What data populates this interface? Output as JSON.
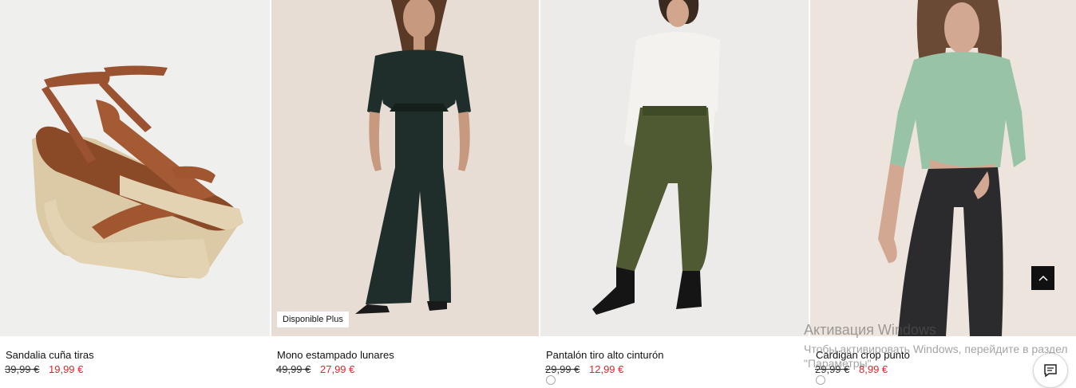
{
  "products": [
    {
      "name": "Sandalia cuña tiras",
      "old_price": "39,99 €",
      "sale_price": "19,99 €",
      "image_icon": "wedge-sandal-photo"
    },
    {
      "name": "Mono estampado lunares",
      "old_price": "49,99 €",
      "sale_price": "27,99 €",
      "badge": "Disponible Plus",
      "image_icon": "jumpsuit-photo"
    },
    {
      "name": "Pantalón tiro alto cinturón",
      "old_price": "29,99 €",
      "sale_price": "12,99 €",
      "image_icon": "khaki-trousers-photo"
    },
    {
      "name": "Cardigan crop punto",
      "old_price": "29,99 €",
      "sale_price": "8,99 €",
      "image_icon": "green-cardigan-photo"
    }
  ],
  "colors": {
    "sale": "#e0262b",
    "dark": "#111111"
  },
  "scroll_top_icon": "chevron-up-icon",
  "chat_icon": "chat-icon",
  "windows_watermark": {
    "title": "Активация Windows",
    "text": "Чтобы активировать Windows, перейдите в раздел \"Параметры\"."
  }
}
